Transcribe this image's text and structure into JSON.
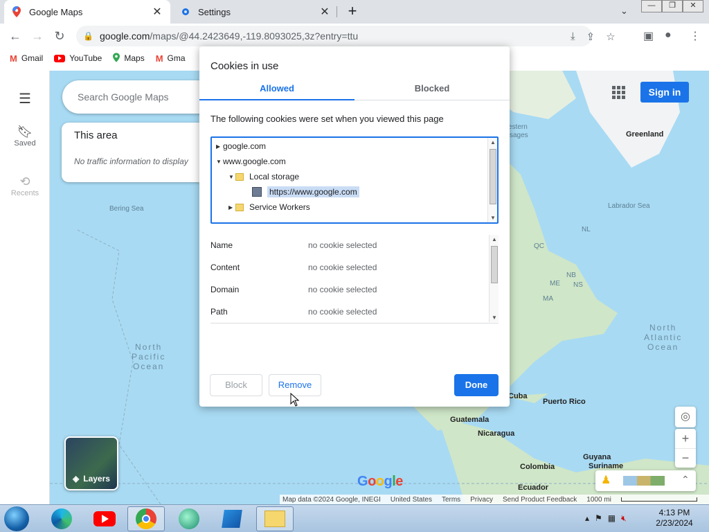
{
  "browser": {
    "tabs": [
      {
        "title": "Google Maps",
        "icon": "maps-pin-icon"
      },
      {
        "title": "Settings",
        "icon": "gear-icon"
      }
    ],
    "url_host": "google.com",
    "url_path": "/maps/@44.2423649,-119.8093025,3z?entry=ttu",
    "bookmarks": [
      {
        "label": "Gmail",
        "icon": "gmail-icon"
      },
      {
        "label": "YouTube",
        "icon": "youtube-icon"
      },
      {
        "label": "Maps",
        "icon": "maps-pin-icon"
      },
      {
        "label": "Gma",
        "icon": "gmail-icon"
      }
    ]
  },
  "maps": {
    "search_placeholder": "Search Google Maps",
    "rail": {
      "saved": "Saved",
      "recents": "Recents"
    },
    "this_area": {
      "title": "This area",
      "text": "No traffic information to display"
    },
    "signin": "Sign in",
    "layers": "Layers",
    "labels": {
      "bering": "Bering Sea",
      "pacific1": "North",
      "pacific2": "Pacific",
      "pacific3": "Ocean",
      "atlantic1": "North",
      "atlantic2": "Atlantic",
      "atlantic3": "Ocean",
      "greenland": "Greenland",
      "labrador": "Labrador Sea",
      "western1": "estern",
      "western2": "sages",
      "nl": "NL",
      "qc": "QC",
      "me": "ME",
      "ns": "NS",
      "nb": "NB",
      "ma": "MA",
      "cuba": "Cuba",
      "puertorico": "Puerto Rico",
      "guatemala": "Guatemala",
      "nicaragua": "Nicaragua",
      "colombia": "Colombia",
      "guyana": "Guyana",
      "suriname": "Suriname",
      "ecuador": "Ecuador"
    },
    "google_logo": "Google",
    "footer": [
      "Map data ©2024 Google, INEGI",
      "United States",
      "Terms",
      "Privacy",
      "Send Product Feedback",
      "1000 mi"
    ]
  },
  "dialog": {
    "title": "Cookies in use",
    "tab_allowed": "Allowed",
    "tab_blocked": "Blocked",
    "description": "The following cookies were set when you viewed this page",
    "tree": {
      "row1": "google.com",
      "row2": "www.google.com",
      "row3": "Local storage",
      "row4": "https://www.google.com",
      "row5": "Service Workers"
    },
    "details": [
      {
        "key": "Name",
        "value": "no cookie selected"
      },
      {
        "key": "Content",
        "value": "no cookie selected"
      },
      {
        "key": "Domain",
        "value": "no cookie selected"
      },
      {
        "key": "Path",
        "value": "no cookie selected"
      }
    ],
    "btn_block": "Block",
    "btn_remove": "Remove",
    "btn_done": "Done"
  },
  "taskbar": {
    "time": "4:13 PM",
    "date": "2/23/2024"
  },
  "colors": {
    "accent": "#1a73e8",
    "map_water": "#a8daf3",
    "land": "#cfe6c8"
  }
}
